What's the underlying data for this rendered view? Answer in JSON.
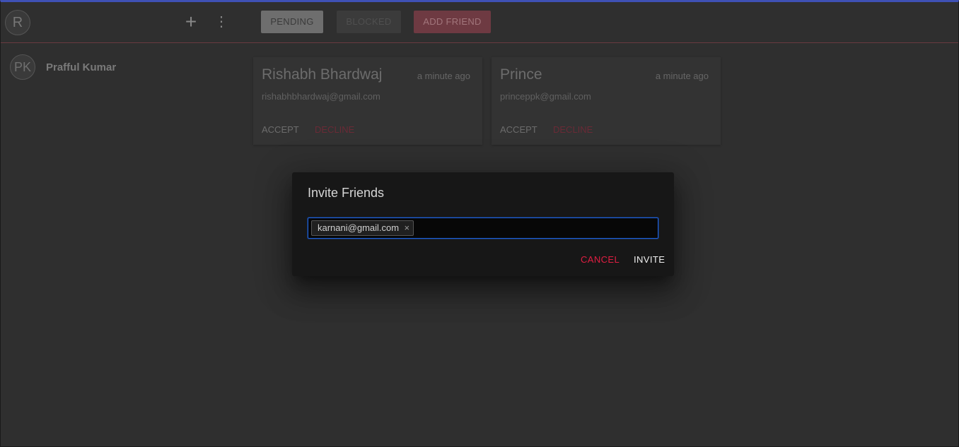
{
  "header": {
    "user_initial": "R",
    "add_icon": "plus-icon",
    "more_icon": "more-vertical-icon",
    "tabs": {
      "pending": "PENDING",
      "blocked": "BLOCKED",
      "add_friend": "ADD FRIEND"
    }
  },
  "sidebar": {
    "contacts": [
      {
        "initials": "PK",
        "name": "Prafful Kumar"
      }
    ]
  },
  "requests": [
    {
      "name": "Rishabh Bhardwaj",
      "time": "a minute ago",
      "email": "rishabhbhardwaj@gmail.com",
      "accept": "ACCEPT",
      "decline": "DECLINE"
    },
    {
      "name": "Prince",
      "time": "a minute ago",
      "email": "princeppk@gmail.com",
      "accept": "ACCEPT",
      "decline": "DECLINE"
    }
  ],
  "dialog": {
    "title": "Invite Friends",
    "chips": [
      {
        "email": "karnani@gmail.com",
        "remove_icon": "close-icon"
      }
    ],
    "cancel": "CANCEL",
    "invite": "INVITE"
  },
  "colors": {
    "accent_blue": "#3f51b5",
    "danger_red": "#e01e42",
    "background": "#2f2f2f",
    "dialog_bg": "#171717"
  }
}
